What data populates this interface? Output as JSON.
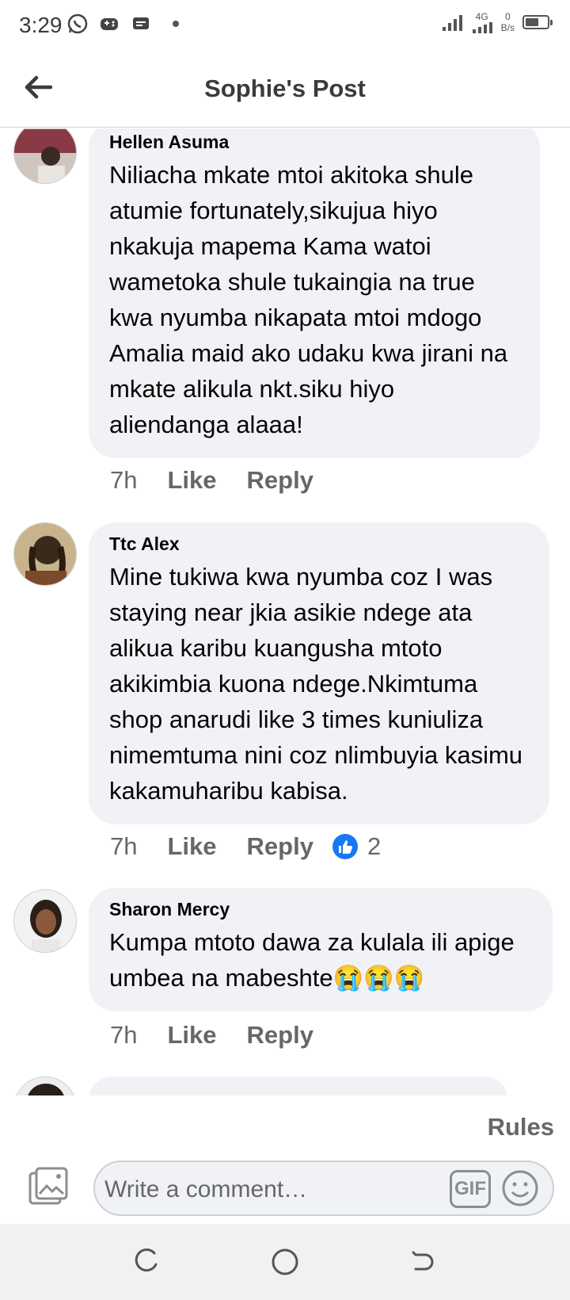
{
  "status": {
    "time": "3:29",
    "network": "4G",
    "speed_value": "0",
    "speed_unit": "B/s",
    "battery_level": 0.6
  },
  "header": {
    "title": "Sophie's Post"
  },
  "comments": [
    {
      "author": "Hellen Asuma",
      "text": "Niliacha mkate mtoi akitoka shule atumie fortunately,sikujua hiyo nkakuja mapema Kama watoi wametoka shule tukaingia na true kwa nyumba nikapata mtoi mdogo Amalia maid ako udaku kwa jirani na mkate alikula nkt.siku hiyo aliendanga alaaa!",
      "time": "7h",
      "like_label": "Like",
      "reply_label": "Reply"
    },
    {
      "author": "Ttc Alex",
      "text": "Mine tukiwa kwa nyumba coz I was staying near jkia asikie ndege ata alikua karibu kuangusha mtoto akikimbia kuona  ndege.Nkimtuma shop anarudi like 3 times kuniuliza nimemtuma nini coz nlimbuyia kasimu kakamuharibu kabisa.",
      "time": "7h",
      "like_label": "Like",
      "reply_label": "Reply",
      "reaction_count": "2"
    },
    {
      "author": "Sharon Mercy",
      "text": "Kumpa mtoto dawa za kulala ili apige umbea na mabeshte😭😭😭",
      "time": "7h",
      "like_label": "Like",
      "reply_label": "Reply"
    }
  ],
  "composer": {
    "rules_label": "Rules",
    "placeholder": "Write a comment…",
    "gif_label": "GIF"
  },
  "colors": {
    "bubble": "#f0f2f5",
    "meta_text": "#65676b",
    "like_blue": "#1877f2"
  }
}
